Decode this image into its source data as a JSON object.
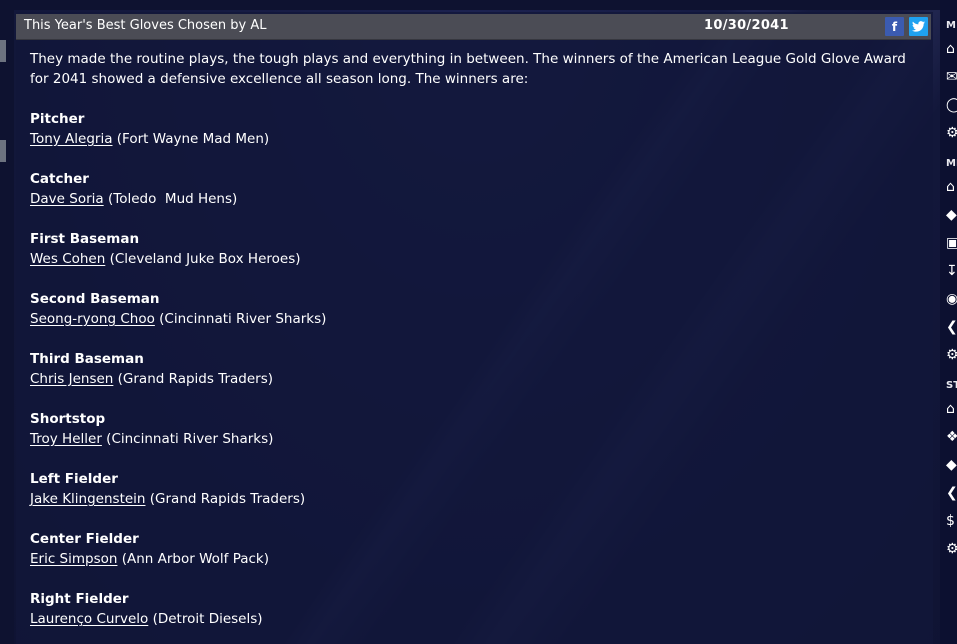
{
  "header": {
    "title": "This Year's Best Gloves Chosen by AL",
    "date": "10/30/2041",
    "facebook_glyph": "f",
    "twitter_glyph": "t"
  },
  "intro": "They made the routine plays, the tough plays and everything in between. The winners of the American League Gold Glove Award for 2041 showed a defensive excellence all season long. The winners are:",
  "awards": [
    {
      "position": "Pitcher",
      "player": "Tony Alegria",
      "team": "(Fort Wayne Mad Men)"
    },
    {
      "position": "Catcher",
      "player": "Dave Soria",
      "team": "(Toledo  Mud Hens)"
    },
    {
      "position": "First Baseman",
      "player": "Wes Cohen",
      "team": "(Cleveland Juke Box Heroes)"
    },
    {
      "position": "Second Baseman",
      "player": "Seong-ryong Choo",
      "team": "(Cincinnati River Sharks)"
    },
    {
      "position": "Third Baseman",
      "player": "Chris Jensen",
      "team": "(Grand Rapids Traders)"
    },
    {
      "position": "Shortstop",
      "player": "Troy Heller",
      "team": "(Cincinnati River Sharks)"
    },
    {
      "position": "Left Fielder",
      "player": "Jake Klingenstein",
      "team": "(Grand Rapids Traders)"
    },
    {
      "position": "Center Fielder",
      "player": "Eric Simpson",
      "team": "(Ann Arbor Wolf Pack)"
    },
    {
      "position": "Right Fielder",
      "player": "Laurenço Curvelo",
      "team": "(Detroit Diesels)"
    }
  ],
  "right_rail": {
    "labels": [
      "M",
      "MI",
      "ST"
    ],
    "icons": [
      "home-icon",
      "mail-icon",
      "search-icon",
      "gear-icon",
      "home-icon",
      "tag-icon",
      "card-icon",
      "download-icon",
      "ball-icon",
      "share-icon",
      "gear-icon",
      "home-icon",
      "stethoscope-icon",
      "tag-icon",
      "share-icon",
      "dollar-icon",
      "gear-icon"
    ]
  },
  "colors": {
    "background": "#141a3c",
    "header_bar": "#4b4c55",
    "facebook": "#3b5bb0",
    "twitter": "#1fa2f0"
  }
}
